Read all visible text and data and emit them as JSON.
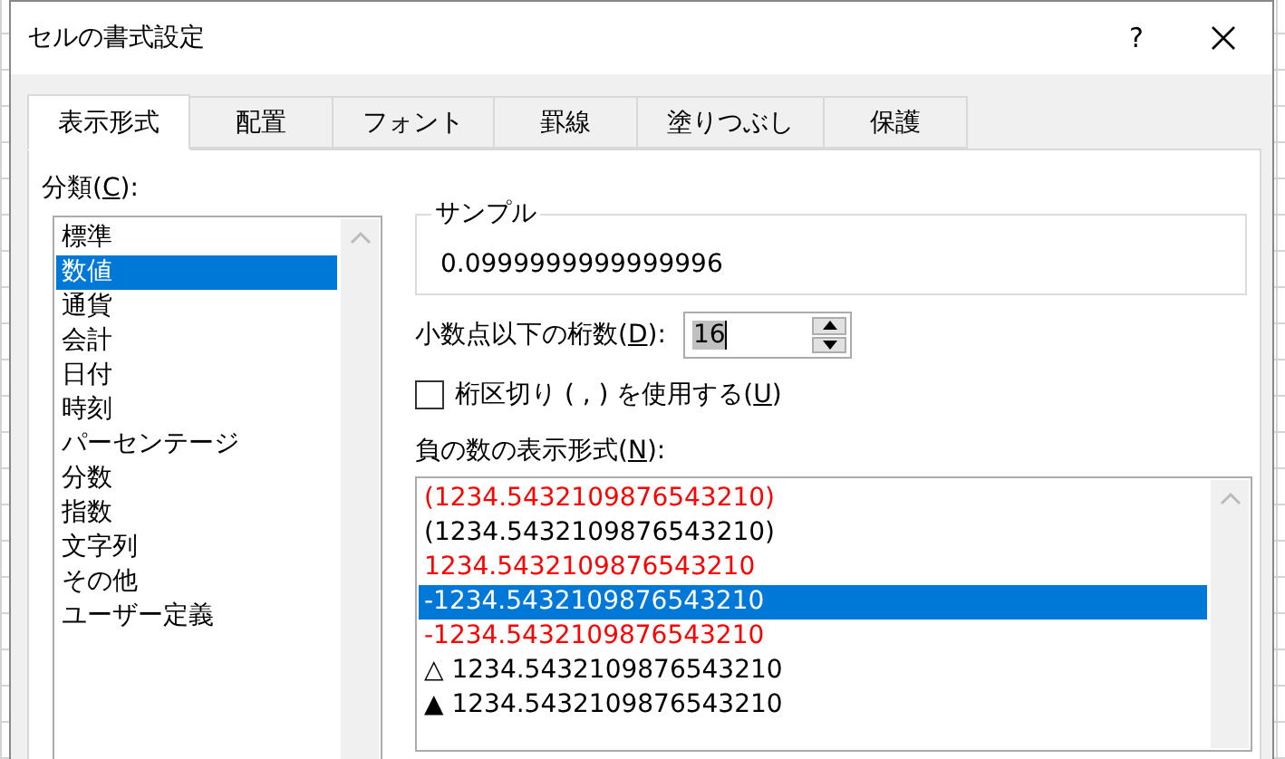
{
  "window": {
    "title": "セルの書式設定",
    "help": "?"
  },
  "tabs": [
    {
      "label": "表示形式",
      "selected": true
    },
    {
      "label": "配置",
      "selected": false
    },
    {
      "label": "フォント",
      "selected": false
    },
    {
      "label": "罫線",
      "selected": false
    },
    {
      "label": "塗りつぶし",
      "selected": false
    },
    {
      "label": "保護",
      "selected": false
    }
  ],
  "category": {
    "label": {
      "before": "分類(",
      "key": "C",
      "after": "):"
    },
    "items": [
      {
        "label": "標準",
        "selected": false
      },
      {
        "label": "数値",
        "selected": true
      },
      {
        "label": "通貨",
        "selected": false
      },
      {
        "label": "会計",
        "selected": false
      },
      {
        "label": "日付",
        "selected": false
      },
      {
        "label": "時刻",
        "selected": false
      },
      {
        "label": "パーセンテージ",
        "selected": false
      },
      {
        "label": "分数",
        "selected": false
      },
      {
        "label": "指数",
        "selected": false
      },
      {
        "label": "文字列",
        "selected": false
      },
      {
        "label": "その他",
        "selected": false
      },
      {
        "label": "ユーザー定義",
        "selected": false
      }
    ]
  },
  "sample": {
    "title": "サンプル",
    "value": "0.0999999999999996"
  },
  "decimal_places": {
    "label": {
      "before": "小数点以下の桁数(",
      "key": "D",
      "after": "):"
    },
    "value": "16"
  },
  "thousands_separator": {
    "label": {
      "before": "桁区切り ( , ) を使用する(",
      "key": "U",
      "after": ")"
    },
    "checked": false
  },
  "negative_numbers": {
    "label": {
      "before": "負の数の表示形式(",
      "key": "N",
      "after": "):"
    },
    "items": [
      {
        "text": "(1234.5432109876543210)",
        "color": "#ff0000",
        "selected": false
      },
      {
        "text": "(1234.5432109876543210)",
        "color": "#000000",
        "selected": false
      },
      {
        "text": "1234.5432109876543210",
        "color": "#ff0000",
        "selected": false
      },
      {
        "text": "-1234.5432109876543210",
        "selected": true
      },
      {
        "text": "-1234.5432109876543210",
        "color": "#ff0000",
        "selected": false
      },
      {
        "text": "△ 1234.5432109876543210",
        "color": "#000000",
        "selected": false
      },
      {
        "text": "▲ 1234.5432109876543210",
        "color": "#000000",
        "selected": false
      }
    ]
  }
}
